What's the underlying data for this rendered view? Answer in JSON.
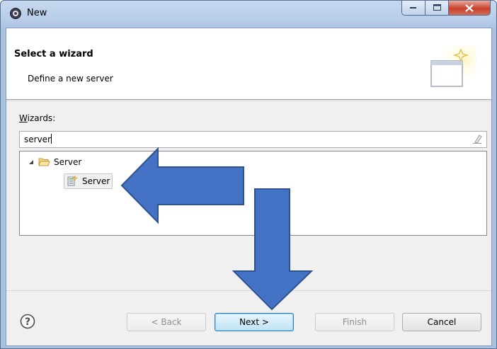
{
  "window": {
    "title": "New",
    "icon": "eclipse-gear-icon"
  },
  "header": {
    "title": "Select a wizard",
    "description": "Define a new server",
    "graphic_icon": "new-wizard-icon"
  },
  "wizards": {
    "label": "Wizards:",
    "filter_value": "server",
    "clear_icon": "eraser-icon",
    "tree": [
      {
        "label": "Server",
        "icon": "folder-open-icon",
        "expanded": true,
        "children": [
          {
            "label": "Server",
            "icon": "server-wizard-icon",
            "selected": true
          }
        ]
      }
    ]
  },
  "buttons": {
    "back": "< Back",
    "next": "Next >",
    "finish": "Finish",
    "cancel": "Cancel",
    "help_icon": "help-icon"
  },
  "colors": {
    "annotation_arrow": "#4472c4",
    "annotation_arrow_border": "#2f528f"
  }
}
